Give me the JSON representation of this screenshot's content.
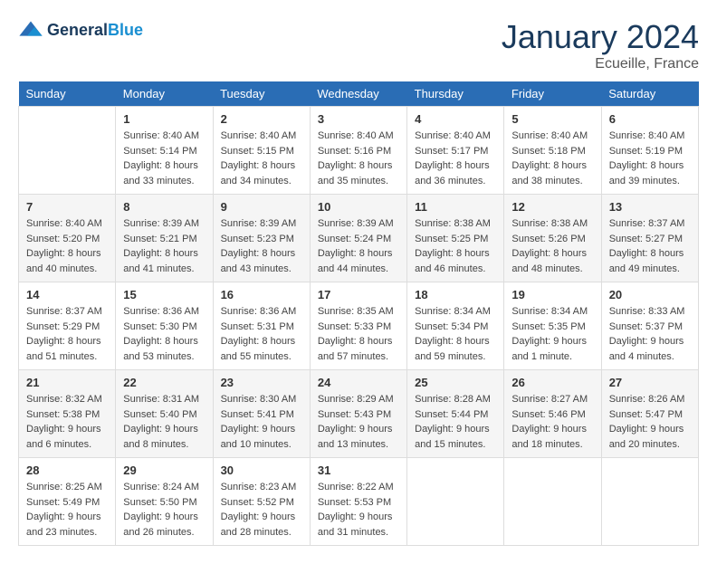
{
  "header": {
    "logo_line1": "General",
    "logo_line2": "Blue",
    "month_year": "January 2024",
    "location": "Ecueille, France"
  },
  "weekdays": [
    "Sunday",
    "Monday",
    "Tuesday",
    "Wednesday",
    "Thursday",
    "Friday",
    "Saturday"
  ],
  "weeks": [
    [
      {
        "day": "",
        "sunrise": "",
        "sunset": "",
        "daylight": ""
      },
      {
        "day": "1",
        "sunrise": "Sunrise: 8:40 AM",
        "sunset": "Sunset: 5:14 PM",
        "daylight": "Daylight: 8 hours and 33 minutes."
      },
      {
        "day": "2",
        "sunrise": "Sunrise: 8:40 AM",
        "sunset": "Sunset: 5:15 PM",
        "daylight": "Daylight: 8 hours and 34 minutes."
      },
      {
        "day": "3",
        "sunrise": "Sunrise: 8:40 AM",
        "sunset": "Sunset: 5:16 PM",
        "daylight": "Daylight: 8 hours and 35 minutes."
      },
      {
        "day": "4",
        "sunrise": "Sunrise: 8:40 AM",
        "sunset": "Sunset: 5:17 PM",
        "daylight": "Daylight: 8 hours and 36 minutes."
      },
      {
        "day": "5",
        "sunrise": "Sunrise: 8:40 AM",
        "sunset": "Sunset: 5:18 PM",
        "daylight": "Daylight: 8 hours and 38 minutes."
      },
      {
        "day": "6",
        "sunrise": "Sunrise: 8:40 AM",
        "sunset": "Sunset: 5:19 PM",
        "daylight": "Daylight: 8 hours and 39 minutes."
      }
    ],
    [
      {
        "day": "7",
        "sunrise": "Sunrise: 8:40 AM",
        "sunset": "Sunset: 5:20 PM",
        "daylight": "Daylight: 8 hours and 40 minutes."
      },
      {
        "day": "8",
        "sunrise": "Sunrise: 8:39 AM",
        "sunset": "Sunset: 5:21 PM",
        "daylight": "Daylight: 8 hours and 41 minutes."
      },
      {
        "day": "9",
        "sunrise": "Sunrise: 8:39 AM",
        "sunset": "Sunset: 5:23 PM",
        "daylight": "Daylight: 8 hours and 43 minutes."
      },
      {
        "day": "10",
        "sunrise": "Sunrise: 8:39 AM",
        "sunset": "Sunset: 5:24 PM",
        "daylight": "Daylight: 8 hours and 44 minutes."
      },
      {
        "day": "11",
        "sunrise": "Sunrise: 8:38 AM",
        "sunset": "Sunset: 5:25 PM",
        "daylight": "Daylight: 8 hours and 46 minutes."
      },
      {
        "day": "12",
        "sunrise": "Sunrise: 8:38 AM",
        "sunset": "Sunset: 5:26 PM",
        "daylight": "Daylight: 8 hours and 48 minutes."
      },
      {
        "day": "13",
        "sunrise": "Sunrise: 8:37 AM",
        "sunset": "Sunset: 5:27 PM",
        "daylight": "Daylight: 8 hours and 49 minutes."
      }
    ],
    [
      {
        "day": "14",
        "sunrise": "Sunrise: 8:37 AM",
        "sunset": "Sunset: 5:29 PM",
        "daylight": "Daylight: 8 hours and 51 minutes."
      },
      {
        "day": "15",
        "sunrise": "Sunrise: 8:36 AM",
        "sunset": "Sunset: 5:30 PM",
        "daylight": "Daylight: 8 hours and 53 minutes."
      },
      {
        "day": "16",
        "sunrise": "Sunrise: 8:36 AM",
        "sunset": "Sunset: 5:31 PM",
        "daylight": "Daylight: 8 hours and 55 minutes."
      },
      {
        "day": "17",
        "sunrise": "Sunrise: 8:35 AM",
        "sunset": "Sunset: 5:33 PM",
        "daylight": "Daylight: 8 hours and 57 minutes."
      },
      {
        "day": "18",
        "sunrise": "Sunrise: 8:34 AM",
        "sunset": "Sunset: 5:34 PM",
        "daylight": "Daylight: 8 hours and 59 minutes."
      },
      {
        "day": "19",
        "sunrise": "Sunrise: 8:34 AM",
        "sunset": "Sunset: 5:35 PM",
        "daylight": "Daylight: 9 hours and 1 minute."
      },
      {
        "day": "20",
        "sunrise": "Sunrise: 8:33 AM",
        "sunset": "Sunset: 5:37 PM",
        "daylight": "Daylight: 9 hours and 4 minutes."
      }
    ],
    [
      {
        "day": "21",
        "sunrise": "Sunrise: 8:32 AM",
        "sunset": "Sunset: 5:38 PM",
        "daylight": "Daylight: 9 hours and 6 minutes."
      },
      {
        "day": "22",
        "sunrise": "Sunrise: 8:31 AM",
        "sunset": "Sunset: 5:40 PM",
        "daylight": "Daylight: 9 hours and 8 minutes."
      },
      {
        "day": "23",
        "sunrise": "Sunrise: 8:30 AM",
        "sunset": "Sunset: 5:41 PM",
        "daylight": "Daylight: 9 hours and 10 minutes."
      },
      {
        "day": "24",
        "sunrise": "Sunrise: 8:29 AM",
        "sunset": "Sunset: 5:43 PM",
        "daylight": "Daylight: 9 hours and 13 minutes."
      },
      {
        "day": "25",
        "sunrise": "Sunrise: 8:28 AM",
        "sunset": "Sunset: 5:44 PM",
        "daylight": "Daylight: 9 hours and 15 minutes."
      },
      {
        "day": "26",
        "sunrise": "Sunrise: 8:27 AM",
        "sunset": "Sunset: 5:46 PM",
        "daylight": "Daylight: 9 hours and 18 minutes."
      },
      {
        "day": "27",
        "sunrise": "Sunrise: 8:26 AM",
        "sunset": "Sunset: 5:47 PM",
        "daylight": "Daylight: 9 hours and 20 minutes."
      }
    ],
    [
      {
        "day": "28",
        "sunrise": "Sunrise: 8:25 AM",
        "sunset": "Sunset: 5:49 PM",
        "daylight": "Daylight: 9 hours and 23 minutes."
      },
      {
        "day": "29",
        "sunrise": "Sunrise: 8:24 AM",
        "sunset": "Sunset: 5:50 PM",
        "daylight": "Daylight: 9 hours and 26 minutes."
      },
      {
        "day": "30",
        "sunrise": "Sunrise: 8:23 AM",
        "sunset": "Sunset: 5:52 PM",
        "daylight": "Daylight: 9 hours and 28 minutes."
      },
      {
        "day": "31",
        "sunrise": "Sunrise: 8:22 AM",
        "sunset": "Sunset: 5:53 PM",
        "daylight": "Daylight: 9 hours and 31 minutes."
      },
      {
        "day": "",
        "sunrise": "",
        "sunset": "",
        "daylight": ""
      },
      {
        "day": "",
        "sunrise": "",
        "sunset": "",
        "daylight": ""
      },
      {
        "day": "",
        "sunrise": "",
        "sunset": "",
        "daylight": ""
      }
    ]
  ]
}
